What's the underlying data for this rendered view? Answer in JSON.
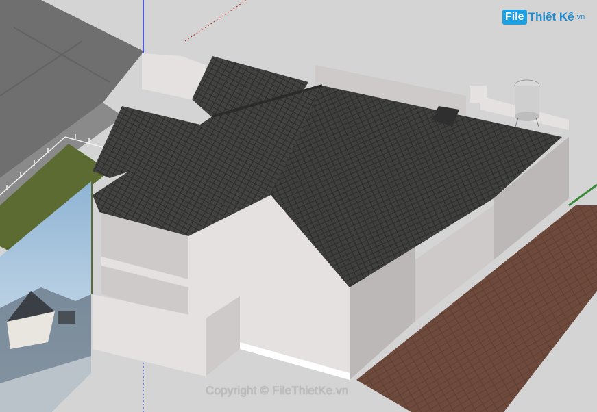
{
  "logo": {
    "box": "File",
    "text": "Thiết Kế",
    "tld": ".vn"
  },
  "watermark": "Copyright © FileThietKe.vn",
  "colors": {
    "background": "#d4d4d4",
    "roof": "#3f3f3e",
    "wall_light": "#e5e1e1",
    "wall_mid": "#cfcaca",
    "wall_dark": "#bcb8b8",
    "grass": "#5b6b32",
    "brick": "#6e4a3c",
    "road": "#6f6f6f",
    "axis_blue": "#2233dd",
    "axis_red": "#cc2222"
  },
  "icons": {
    "water_tank": "water-tank-icon"
  }
}
